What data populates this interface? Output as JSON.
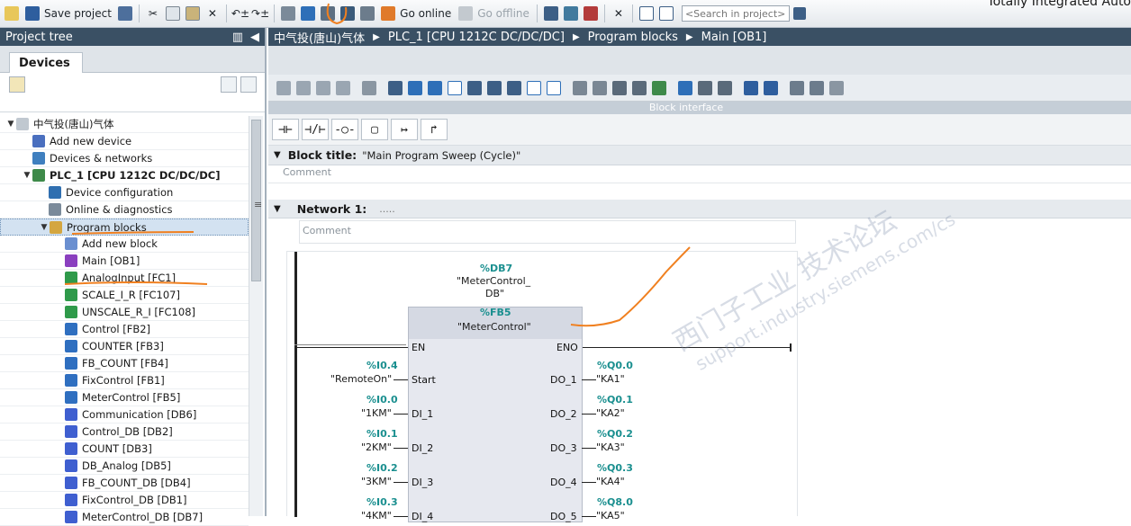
{
  "toolbar": {
    "save_project": "Save project",
    "go_online": "Go online",
    "go_offline": "Go offline",
    "search_placeholder": "<Search in project>",
    "brand": "Totally Integrated Auto"
  },
  "project_tree": {
    "header": "Project tree",
    "tab": "Devices",
    "items": [
      {
        "label": "中气投(唐山)气体",
        "level": 0,
        "expand": "▼",
        "icon": "project-icon",
        "color": "#c0c8d0"
      },
      {
        "label": "Add new device",
        "level": 1,
        "expand": "",
        "icon": "add-device-icon",
        "color": "#4a6fbf"
      },
      {
        "label": "Devices & networks",
        "level": 1,
        "expand": "",
        "icon": "network-icon",
        "color": "#3f7fbf"
      },
      {
        "label": "PLC_1 [CPU 1212C DC/DC/DC]",
        "level": 1,
        "expand": "▼",
        "icon": "plc-icon",
        "color": "#3e8a4a",
        "bold": true
      },
      {
        "label": "Device configuration",
        "level": 2,
        "expand": "",
        "icon": "device-config-icon",
        "color": "#2f6fb0"
      },
      {
        "label": "Online & diagnostics",
        "level": 2,
        "expand": "",
        "icon": "diagnostics-icon",
        "color": "#7a8a9a"
      },
      {
        "label": "Program blocks",
        "level": 2,
        "expand": "▼",
        "icon": "folder-icon",
        "color": "#d4a640",
        "selected": true
      },
      {
        "label": "Add new block",
        "level": 3,
        "expand": "",
        "icon": "add-block-icon",
        "color": "#6a8fd0"
      },
      {
        "label": "Main [OB1]",
        "level": 3,
        "expand": "",
        "icon": "ob-icon",
        "color": "#8a3fbf"
      },
      {
        "label": "AnalogInput [FC1]",
        "level": 3,
        "expand": "",
        "icon": "fc-icon",
        "color": "#2f9a4a"
      },
      {
        "label": "SCALE_I_R [FC107]",
        "level": 3,
        "expand": "",
        "icon": "fc-icon",
        "color": "#2f9a4a"
      },
      {
        "label": "UNSCALE_R_I [FC108]",
        "level": 3,
        "expand": "",
        "icon": "fc-icon",
        "color": "#2f9a4a"
      },
      {
        "label": "Control [FB2]",
        "level": 3,
        "expand": "",
        "icon": "fb-icon",
        "color": "#2f6fc0"
      },
      {
        "label": "COUNTER [FB3]",
        "level": 3,
        "expand": "",
        "icon": "fb-icon",
        "color": "#2f6fc0"
      },
      {
        "label": "FB_COUNT [FB4]",
        "level": 3,
        "expand": "",
        "icon": "fb-icon",
        "color": "#2f6fc0"
      },
      {
        "label": "FixControl [FB1]",
        "level": 3,
        "expand": "",
        "icon": "fb-icon",
        "color": "#2f6fc0"
      },
      {
        "label": "MeterControl [FB5]",
        "level": 3,
        "expand": "",
        "icon": "fb-icon",
        "color": "#2f6fc0"
      },
      {
        "label": "Communication [DB6]",
        "level": 3,
        "expand": "",
        "icon": "db-icon",
        "color": "#3f5fd0"
      },
      {
        "label": "Control_DB [DB2]",
        "level": 3,
        "expand": "",
        "icon": "db-icon",
        "color": "#3f5fd0"
      },
      {
        "label": "COUNT [DB3]",
        "level": 3,
        "expand": "",
        "icon": "db-icon",
        "color": "#3f5fd0"
      },
      {
        "label": "DB_Analog [DB5]",
        "level": 3,
        "expand": "",
        "icon": "db-icon",
        "color": "#3f5fd0"
      },
      {
        "label": "FB_COUNT_DB [DB4]",
        "level": 3,
        "expand": "",
        "icon": "db-icon",
        "color": "#3f5fd0"
      },
      {
        "label": "FixControl_DB [DB1]",
        "level": 3,
        "expand": "",
        "icon": "db-icon",
        "color": "#3f5fd0"
      },
      {
        "label": "MeterControl_DB [DB7]",
        "level": 3,
        "expand": "",
        "icon": "db-icon",
        "color": "#3f5fd0"
      }
    ]
  },
  "breadcrumb": [
    "中气投(唐山)气体",
    "PLC_1 [CPU 1212C DC/DC/DC]",
    "Program blocks",
    "Main [OB1]"
  ],
  "editor": {
    "block_interface": "Block interface",
    "block_title_label": "Block title:",
    "block_title_value": "\"Main Program Sweep (Cycle)\"",
    "comment": "Comment",
    "network_label": "Network 1:",
    "network_title": ".....",
    "network_comment": "Comment"
  },
  "fb": {
    "db_address": "%DB7",
    "db_name_line1": "\"MeterControl_",
    "db_name_line2": "DB\"",
    "address": "%FB5",
    "name": "\"MeterControl\"",
    "en": "EN",
    "eno": "ENO",
    "inputs": [
      {
        "pin": "Start",
        "addr": "%I0.4",
        "tag": "\"RemoteOn\""
      },
      {
        "pin": "DI_1",
        "addr": "%I0.0",
        "tag": "\"1KM\""
      },
      {
        "pin": "DI_2",
        "addr": "%I0.1",
        "tag": "\"2KM\""
      },
      {
        "pin": "DI_3",
        "addr": "%I0.2",
        "tag": "\"3KM\""
      },
      {
        "pin": "DI_4",
        "addr": "%I0.3",
        "tag": "\"4KM\""
      }
    ],
    "outputs": [
      {
        "pin": "DO_1",
        "addr": "%Q0.0",
        "tag": "\"KA1\""
      },
      {
        "pin": "DO_2",
        "addr": "%Q0.1",
        "tag": "\"KA2\""
      },
      {
        "pin": "DO_3",
        "addr": "%Q0.2",
        "tag": "\"KA3\""
      },
      {
        "pin": "DO_4",
        "addr": "%Q0.3",
        "tag": "\"KA4\""
      },
      {
        "pin": "DO_5",
        "addr": "%Q8.0",
        "tag": "\"KA5\""
      }
    ]
  },
  "watermark": {
    "line1": "西门子工业  技术论坛",
    "line2": "support.industry.siemens.com/cs"
  },
  "colors": {
    "header_bg": "#3a5064",
    "selection": "#d3e2f1",
    "address": "#1a8f8f",
    "annotation": "#f08020"
  }
}
